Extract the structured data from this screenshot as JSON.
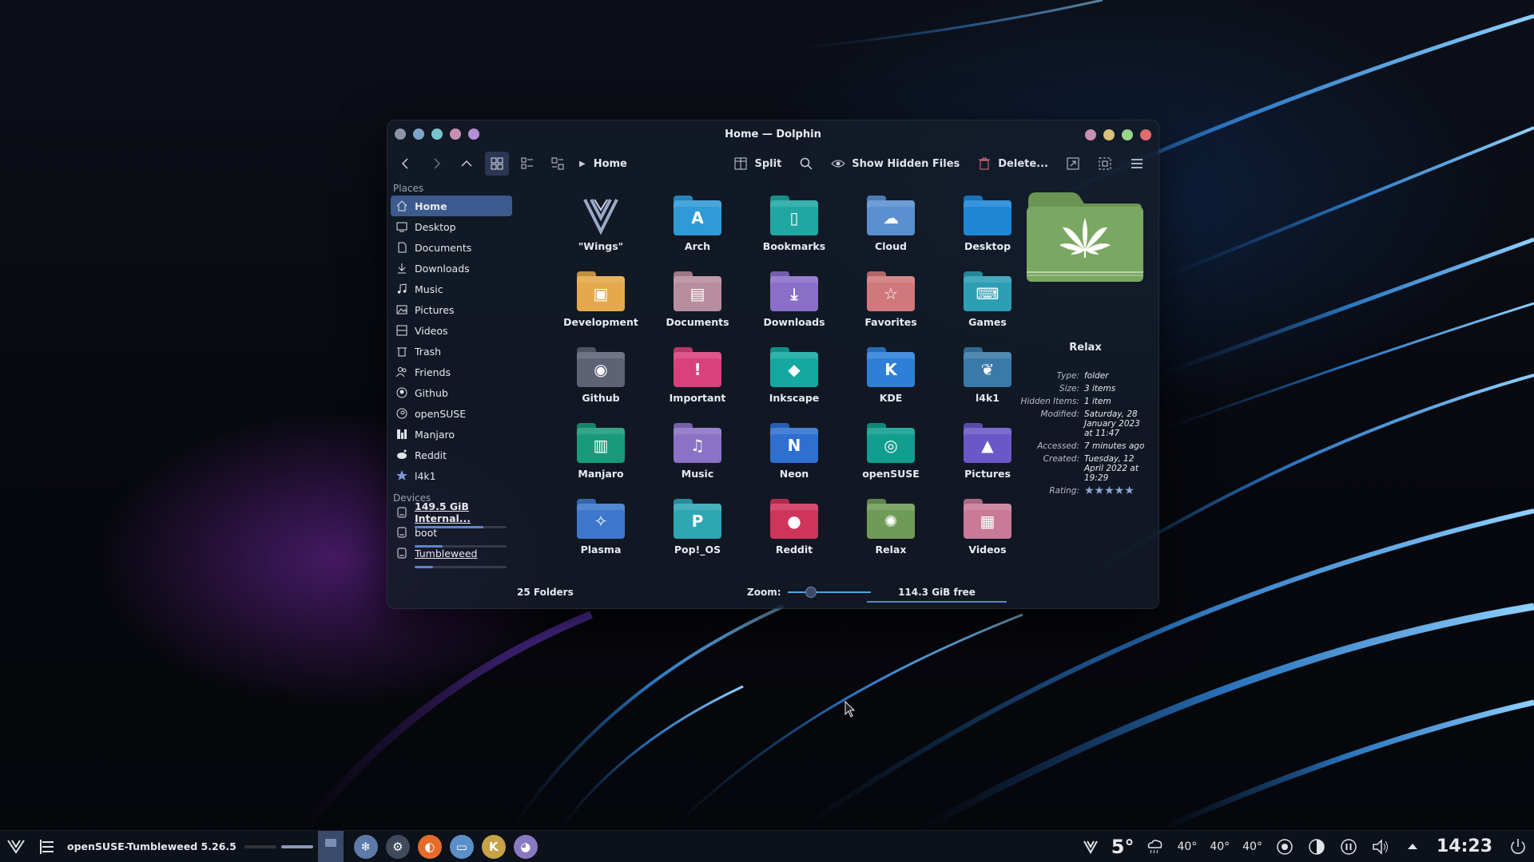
{
  "window": {
    "title": "Home — Dolphin",
    "left_dot_colors": [
      "#8a96a8",
      "#7fa6c9",
      "#77c3cc",
      "#c98fb0",
      "#b58ed8"
    ],
    "right_dot_colors": [
      "#c98fb0",
      "#d9c27a",
      "#9bd38a",
      "#e06c6c"
    ]
  },
  "toolbar": {
    "breadcrumb": "Home",
    "split_label": "Split",
    "show_hidden_label": "Show Hidden Files",
    "delete_label": "Delete..."
  },
  "sidebar": {
    "places_title": "Places",
    "places": [
      {
        "label": "Home",
        "icon": "home-icon",
        "selected": true
      },
      {
        "label": "Desktop",
        "icon": "desktop-icon"
      },
      {
        "label": "Documents",
        "icon": "document-icon"
      },
      {
        "label": "Downloads",
        "icon": "download-icon"
      },
      {
        "label": "Music",
        "icon": "music-icon"
      },
      {
        "label": "Pictures",
        "icon": "picture-icon"
      },
      {
        "label": "Videos",
        "icon": "video-icon"
      },
      {
        "label": "Trash",
        "icon": "trash-icon"
      },
      {
        "label": "Friends",
        "icon": "friends-icon"
      },
      {
        "label": "Github",
        "icon": "github-icon"
      },
      {
        "label": "openSUSE",
        "icon": "opensuse-icon"
      },
      {
        "label": "Manjaro",
        "icon": "manjaro-icon"
      },
      {
        "label": "Reddit",
        "icon": "reddit-icon"
      },
      {
        "label": "l4k1",
        "icon": "star-icon"
      }
    ],
    "devices_title": "Devices",
    "devices": [
      {
        "label": "149.5 GiB Internal...",
        "usage": 0.75
      },
      {
        "label": "boot",
        "usage": 0.3
      },
      {
        "label": "Tumbleweed",
        "usage": 0.2
      }
    ]
  },
  "files": [
    {
      "name": "\"Wings\"",
      "color": "#4a5a7c",
      "glyph": "✦",
      "type": "emblem"
    },
    {
      "name": "Arch",
      "color": "#2e9bd6",
      "glyph": "A"
    },
    {
      "name": "Bookmarks",
      "color": "#1fa8a2",
      "glyph": "▯"
    },
    {
      "name": "Cloud",
      "color": "#5b8fd0",
      "glyph": "☁"
    },
    {
      "name": "Desktop",
      "color": "#1d87d6",
      "glyph": ""
    },
    {
      "name": "Development",
      "color": "#e3a94a",
      "glyph": "▣"
    },
    {
      "name": "Documents",
      "color": "#b88d9e",
      "glyph": "▤"
    },
    {
      "name": "Downloads",
      "color": "#8a6fc9",
      "glyph": "⤓"
    },
    {
      "name": "Favorites",
      "color": "#d0787a",
      "glyph": "☆"
    },
    {
      "name": "Games",
      "color": "#2d9fb4",
      "glyph": "⌨"
    },
    {
      "name": "Github",
      "color": "#5d6275",
      "glyph": "◉"
    },
    {
      "name": "Important",
      "color": "#d9407c",
      "glyph": "!"
    },
    {
      "name": "Inkscape",
      "color": "#13a8a0",
      "glyph": "◆"
    },
    {
      "name": "KDE",
      "color": "#2f7fd8",
      "glyph": "K"
    },
    {
      "name": "l4k1",
      "color": "#3b79a8",
      "glyph": "❦"
    },
    {
      "name": "Manjaro",
      "color": "#1a9a78",
      "glyph": "▥"
    },
    {
      "name": "Music",
      "color": "#8a72c4",
      "glyph": "♫"
    },
    {
      "name": "Neon",
      "color": "#2f6fd0",
      "glyph": "N"
    },
    {
      "name": "openSUSE",
      "color": "#119e8e",
      "glyph": "◎"
    },
    {
      "name": "Pictures",
      "color": "#6a58c8",
      "glyph": "▲"
    },
    {
      "name": "Plasma",
      "color": "#3e78cc",
      "glyph": "✧"
    },
    {
      "name": "Pop!_OS",
      "color": "#2ea6b4",
      "glyph": "P"
    },
    {
      "name": "Reddit",
      "color": "#d0345a",
      "glyph": "●"
    },
    {
      "name": "Relax",
      "color": "#6f9a58",
      "glyph": "✺"
    },
    {
      "name": "Videos",
      "color": "#c87a96",
      "glyph": "▦"
    }
  ],
  "info": {
    "name": "Relax",
    "folder_color": "#7aa761",
    "rows": [
      {
        "key": "Type:",
        "value": "folder"
      },
      {
        "key": "Size:",
        "value": "3 items"
      },
      {
        "key": "Hidden Items:",
        "value": "1 item"
      },
      {
        "key": "Modified:",
        "value": "Saturday, 28 January 2023 at 11:47"
      },
      {
        "key": "Accessed:",
        "value": "7 minutes ago"
      },
      {
        "key": "Created:",
        "value": "Tuesday, 12 April 2022 at 19:29"
      }
    ],
    "rating_label": "Rating:",
    "rating_stars": "★★★★★"
  },
  "status": {
    "count": "25 Folders",
    "zoom_label": "Zoom:",
    "zoom_value": 0.25,
    "free": "114.3 GiB free"
  },
  "taskbar": {
    "task_label": "openSUSE-Tumbleweed 5.26.5",
    "launchers": [
      {
        "icon": "snow-app-icon",
        "color": "#5d7aa8",
        "glyph": "❄"
      },
      {
        "icon": "settings-app-icon",
        "color": "#3f4a5c",
        "glyph": "⚙"
      },
      {
        "icon": "firefox-icon",
        "color": "#e46b2a",
        "glyph": "◐"
      },
      {
        "icon": "dolphin-icon",
        "color": "#5a8fc9",
        "glyph": "▭"
      },
      {
        "icon": "kate-icon",
        "color": "#c7a248",
        "glyph": "K"
      },
      {
        "icon": "color-app-icon",
        "color": "#8a78c2",
        "glyph": "◕"
      }
    ],
    "weather_temp": "5°",
    "temps": [
      "40°",
      "40°",
      "40°"
    ],
    "clock": "14:23"
  }
}
